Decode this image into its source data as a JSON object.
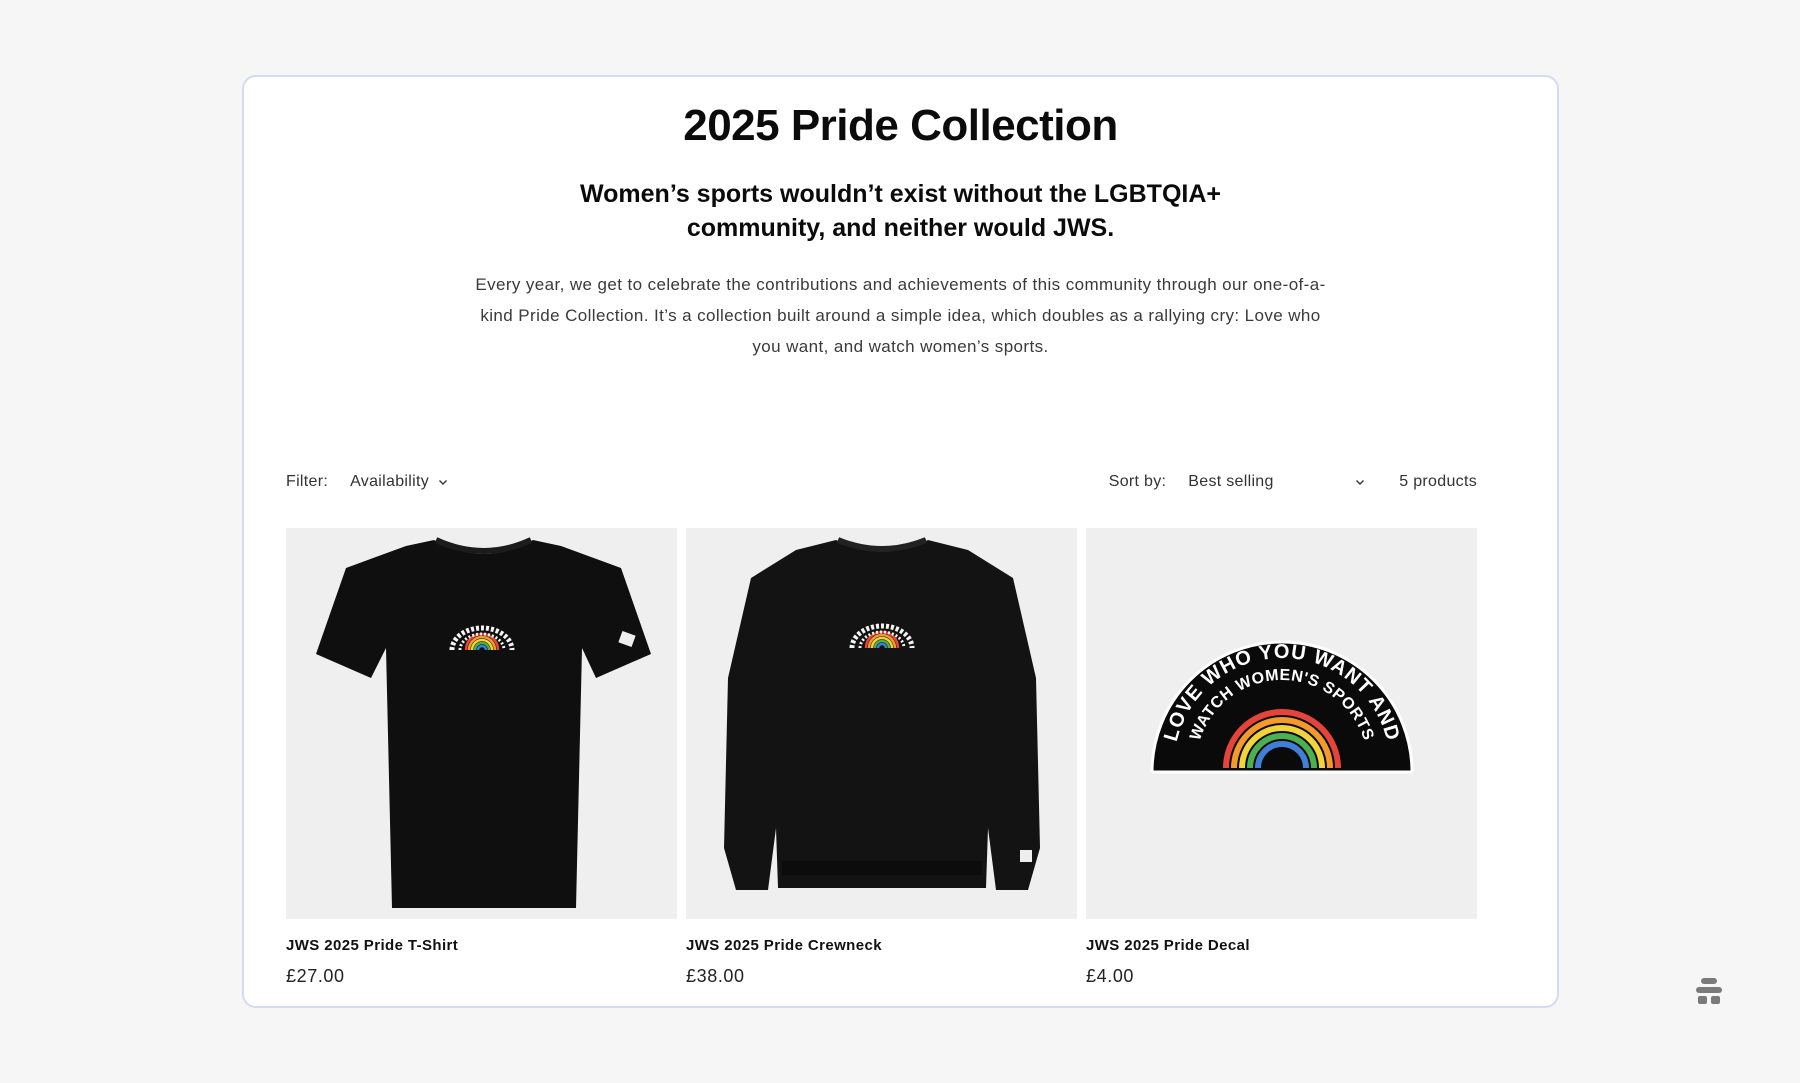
{
  "hero": {
    "title": "2025 Pride Collection",
    "subtitle": "Women’s sports wouldn’t exist without the LGBTQIA+ community, and neither would JWS.",
    "body": "Every year, we get to celebrate the contributions and achievements of this community through our one-of-a-kind Pride Collection. It’s a collection built around a simple idea, which doubles as a rallying cry: Love who you want, and watch women’s sports."
  },
  "toolbar": {
    "filter_label": "Filter:",
    "filter_value": "Availability",
    "sort_label": "Sort by:",
    "sort_value": "Best selling",
    "count": "5 products"
  },
  "products": [
    {
      "name": "JWS 2025 Pride T-Shirt",
      "price": "£27.00",
      "image": "black-tshirt"
    },
    {
      "name": "JWS 2025 Pride Crewneck",
      "price": "£38.00",
      "image": "black-crewneck"
    },
    {
      "name": "JWS 2025 Pride Decal",
      "price": "£4.00",
      "image": "rainbow-decal"
    }
  ],
  "decal_text": {
    "line1": "LOVE WHO YOU WANT AND",
    "line2": "WATCH WOMEN'S SPORTS"
  },
  "colors": {
    "frame_border": "#d4dbf0",
    "image_bg": "#efefef",
    "rainbow": [
      "#e5443b",
      "#f39a2b",
      "#f3d33b",
      "#4caf50",
      "#3f7fd6",
      "#7a4bc2"
    ]
  },
  "icons": {
    "chevron": "chevron-down-icon",
    "corner": "stack-icon"
  }
}
